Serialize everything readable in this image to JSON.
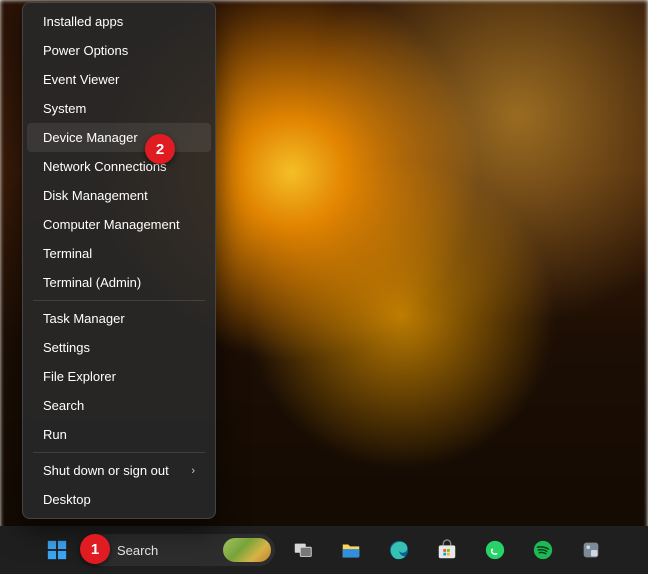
{
  "menu": {
    "groups": [
      [
        {
          "label": "Installed apps"
        },
        {
          "label": "Power Options"
        },
        {
          "label": "Event Viewer"
        },
        {
          "label": "System"
        },
        {
          "label": "Device Manager",
          "highlight": true
        },
        {
          "label": "Network Connections"
        },
        {
          "label": "Disk Management"
        },
        {
          "label": "Computer Management"
        },
        {
          "label": "Terminal"
        },
        {
          "label": "Terminal (Admin)"
        }
      ],
      [
        {
          "label": "Task Manager"
        },
        {
          "label": "Settings"
        },
        {
          "label": "File Explorer"
        },
        {
          "label": "Search"
        },
        {
          "label": "Run"
        }
      ],
      [
        {
          "label": "Shut down or sign out",
          "submenu": true
        },
        {
          "label": "Desktop"
        }
      ]
    ]
  },
  "search": {
    "placeholder": "Search"
  },
  "callouts": {
    "one": "1",
    "two": "2"
  },
  "taskbar_icons": [
    "start",
    "search",
    "task-view",
    "file-explorer",
    "edge",
    "microsoft-store",
    "whatsapp",
    "spotify",
    "app"
  ]
}
